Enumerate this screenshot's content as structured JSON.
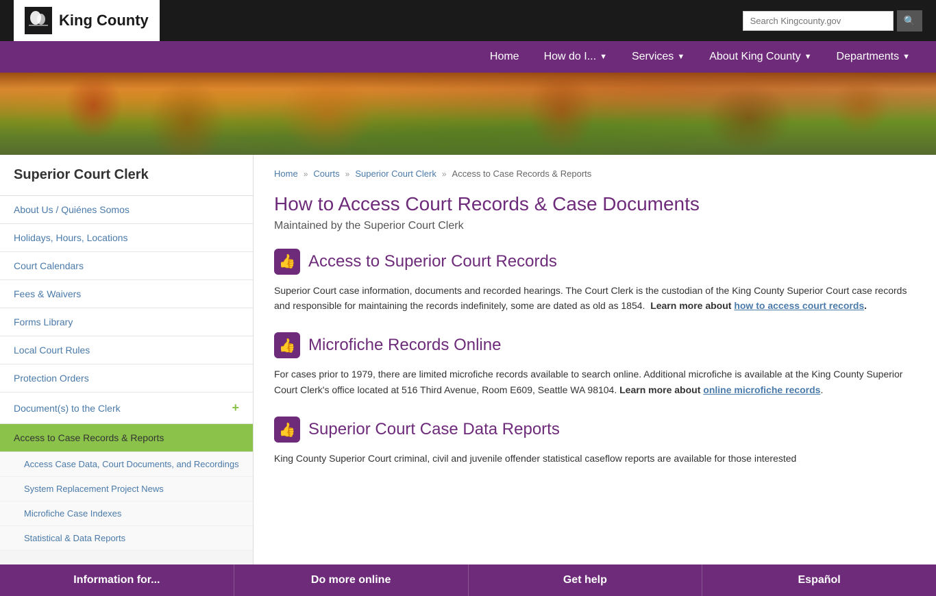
{
  "header": {
    "logo_text": "King County",
    "search_placeholder": "Search Kingcounty.gov"
  },
  "nav": {
    "items": [
      {
        "label": "Home",
        "has_arrow": false
      },
      {
        "label": "How do I...",
        "has_arrow": true
      },
      {
        "label": "Services",
        "has_arrow": true
      },
      {
        "label": "About King County",
        "has_arrow": true
      },
      {
        "label": "Departments",
        "has_arrow": true
      }
    ]
  },
  "sidebar": {
    "title": "Superior Court Clerk",
    "items": [
      {
        "label": "About Us / Quiénes Somos",
        "active": false,
        "has_plus": false
      },
      {
        "label": "Holidays, Hours, Locations",
        "active": false,
        "has_plus": false
      },
      {
        "label": "Court Calendars",
        "active": false,
        "has_plus": false
      },
      {
        "label": "Fees & Waivers",
        "active": false,
        "has_plus": false
      },
      {
        "label": "Forms Library",
        "active": false,
        "has_plus": false
      },
      {
        "label": "Local Court Rules",
        "active": false,
        "has_plus": false
      },
      {
        "label": "Protection Orders",
        "active": false,
        "has_plus": false
      },
      {
        "label": "Document(s) to the Clerk",
        "active": false,
        "has_plus": true
      },
      {
        "label": "Access to Case Records & Reports",
        "active": true,
        "has_plus": false
      }
    ],
    "sub_items": [
      {
        "label": "Access Case Data, Court Documents, and Recordings"
      },
      {
        "label": "System Replacement Project News"
      },
      {
        "label": "Microfiche Case Indexes"
      },
      {
        "label": "Statistical & Data Reports"
      }
    ]
  },
  "breadcrumb": {
    "items": [
      {
        "label": "Home",
        "link": true
      },
      {
        "label": "Courts",
        "link": true
      },
      {
        "label": "Superior Court Clerk",
        "link": true
      },
      {
        "label": "Access to Case Records & Reports",
        "link": false
      }
    ]
  },
  "content": {
    "page_title": "How to Access Court Records & Case Documents",
    "page_subtitle": "Maintained by the Superior Court Clerk",
    "sections": [
      {
        "id": "section1",
        "icon": "👍",
        "title": "Access to Superior Court Records",
        "text_parts": [
          {
            "type": "text",
            "content": "Superior Court case information, documents and recorded hearings. The Court Clerk is the custodian of the King County Superior Court case records and responsible for maintaining the records indefinitely, some are dated as old as 1854.  "
          },
          {
            "type": "bold",
            "content": "Learn more about "
          },
          {
            "type": "link",
            "content": "how to access court records"
          },
          {
            "type": "text",
            "content": "."
          }
        ]
      },
      {
        "id": "section2",
        "icon": "👍",
        "title": "Microfiche Records Online",
        "text_parts": [
          {
            "type": "text",
            "content": "For cases prior to 1979, there are limited microfiche records available to search online. Additional microfiche is available at the King County Superior Court Clerk's office located at 516 Third Avenue, Room E609, Seattle WA 98104. "
          },
          {
            "type": "bold_link",
            "content": "Learn more about online microfiche records"
          },
          {
            "type": "text",
            "content": "."
          }
        ]
      },
      {
        "id": "section3",
        "icon": "👍",
        "title": "Superior Court Case Data Reports",
        "text_parts": [
          {
            "type": "text",
            "content": "King County Superior Court criminal, civil and juvenile offender statistical caseflow reports are available for those interested"
          }
        ]
      }
    ]
  },
  "footer": {
    "items": [
      {
        "label": "Information for..."
      },
      {
        "label": "Do more online"
      },
      {
        "label": "Get help"
      },
      {
        "label": "Español"
      }
    ]
  }
}
